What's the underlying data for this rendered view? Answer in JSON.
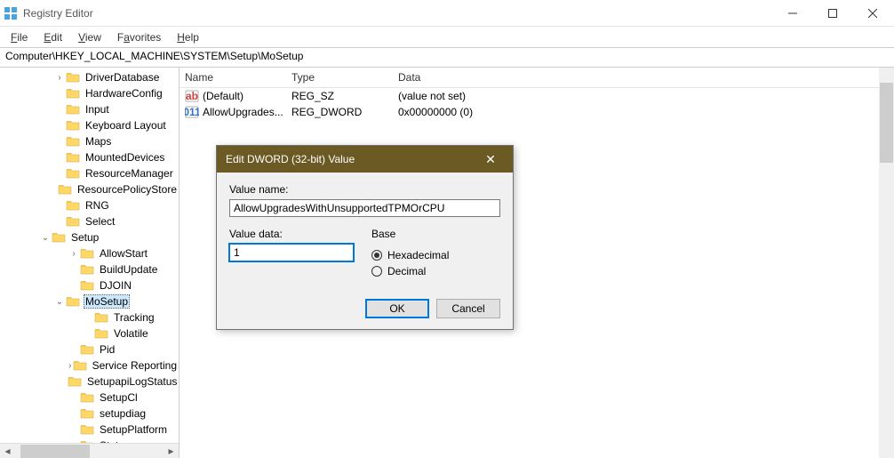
{
  "titlebar": {
    "title": "Registry Editor"
  },
  "menubar": {
    "file": "File",
    "edit": "Edit",
    "view": "View",
    "favorites": "Favorites",
    "help": "Help"
  },
  "address": "Computer\\HKEY_LOCAL_MACHINE\\SYSTEM\\Setup\\MoSetup",
  "tree": {
    "items": [
      {
        "indent": 60,
        "toggle": ">",
        "label": "DriverDatabase"
      },
      {
        "indent": 60,
        "toggle": "",
        "label": "HardwareConfig"
      },
      {
        "indent": 60,
        "toggle": "",
        "label": "Input"
      },
      {
        "indent": 60,
        "toggle": "",
        "label": "Keyboard Layout"
      },
      {
        "indent": 60,
        "toggle": "",
        "label": "Maps"
      },
      {
        "indent": 60,
        "toggle": "",
        "label": "MountedDevices"
      },
      {
        "indent": 60,
        "toggle": "",
        "label": "ResourceManager"
      },
      {
        "indent": 60,
        "toggle": "",
        "label": "ResourcePolicyStore"
      },
      {
        "indent": 60,
        "toggle": "",
        "label": "RNG"
      },
      {
        "indent": 60,
        "toggle": "",
        "label": "Select"
      },
      {
        "indent": 44,
        "toggle": "v",
        "label": "Setup"
      },
      {
        "indent": 76,
        "toggle": ">",
        "label": "AllowStart"
      },
      {
        "indent": 76,
        "toggle": "",
        "label": "BuildUpdate"
      },
      {
        "indent": 76,
        "toggle": "",
        "label": "DJOIN"
      },
      {
        "indent": 60,
        "toggle": "v",
        "label": "MoSetup",
        "selected": true
      },
      {
        "indent": 92,
        "toggle": "",
        "label": "Tracking"
      },
      {
        "indent": 92,
        "toggle": "",
        "label": "Volatile"
      },
      {
        "indent": 76,
        "toggle": "",
        "label": "Pid"
      },
      {
        "indent": 76,
        "toggle": ">",
        "label": "Service Reporting"
      },
      {
        "indent": 76,
        "toggle": "",
        "label": "SetupapiLogStatus"
      },
      {
        "indent": 76,
        "toggle": "",
        "label": "SetupCl"
      },
      {
        "indent": 76,
        "toggle": "",
        "label": "setupdiag"
      },
      {
        "indent": 76,
        "toggle": "",
        "label": "SetupPlatform"
      },
      {
        "indent": 76,
        "toggle": ">",
        "label": "Status"
      }
    ]
  },
  "list": {
    "cols": {
      "name": "Name",
      "type": "Type",
      "data": "Data"
    },
    "rows": [
      {
        "icon": "sz",
        "name": "(Default)",
        "type": "REG_SZ",
        "data": "(value not set)"
      },
      {
        "icon": "dword",
        "name": "AllowUpgrades...",
        "type": "REG_DWORD",
        "data": "0x00000000 (0)"
      }
    ]
  },
  "dialog": {
    "title": "Edit DWORD (32-bit) Value",
    "valueName_label": "Value name:",
    "valueName": "AllowUpgradesWithUnsupportedTPMOrCPU",
    "valueData_label": "Value data:",
    "valueData": "1",
    "base_label": "Base",
    "hex": "Hexadecimal",
    "dec": "Decimal",
    "ok": "OK",
    "cancel": "Cancel"
  }
}
